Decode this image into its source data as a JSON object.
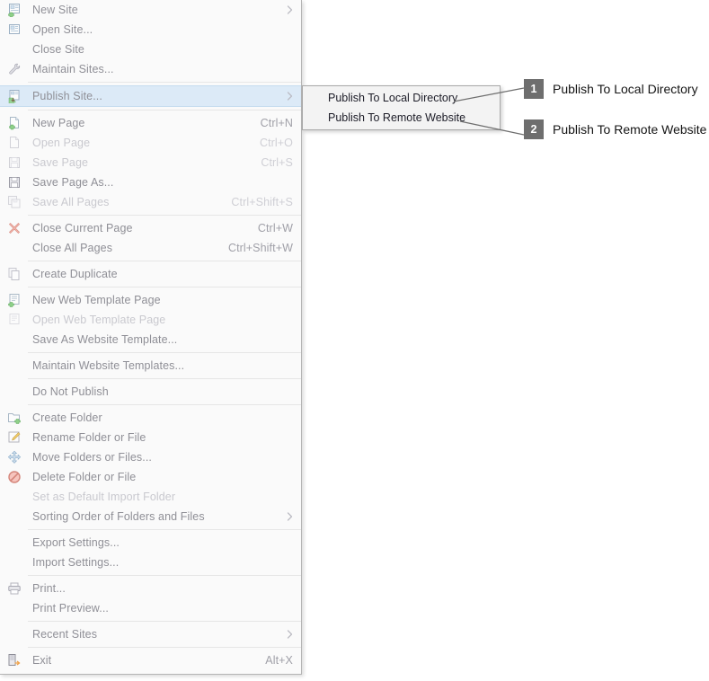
{
  "menu": {
    "title": "File Menu",
    "groups": [
      {
        "items": [
          {
            "label": "New Site",
            "shortcut": "",
            "icon": "new-site-icon",
            "submenu": true,
            "disabled": false
          },
          {
            "label": "Open Site...",
            "shortcut": "",
            "icon": "open-site-icon",
            "submenu": false,
            "disabled": false
          },
          {
            "label": "Close Site",
            "shortcut": "",
            "icon": "",
            "submenu": false,
            "disabled": false
          },
          {
            "label": "Maintain Sites...",
            "shortcut": "",
            "icon": "wrench-icon",
            "submenu": false,
            "disabled": false
          }
        ]
      },
      {
        "items": [
          {
            "label": "Publish Site...",
            "shortcut": "",
            "icon": "publish-site-icon",
            "submenu": true,
            "disabled": false,
            "selected": true
          }
        ]
      },
      {
        "items": [
          {
            "label": "New Page",
            "shortcut": "Ctrl+N",
            "icon": "new-page-icon",
            "submenu": false,
            "disabled": false
          },
          {
            "label": "Open Page",
            "shortcut": "Ctrl+O",
            "icon": "open-page-icon",
            "submenu": false,
            "disabled": true
          },
          {
            "label": "Save Page",
            "shortcut": "Ctrl+S",
            "icon": "save-page-icon",
            "submenu": false,
            "disabled": true
          },
          {
            "label": "Save Page As...",
            "shortcut": "",
            "icon": "save-page-as-icon",
            "submenu": false,
            "disabled": false
          },
          {
            "label": "Save All Pages",
            "shortcut": "Ctrl+Shift+S",
            "icon": "save-all-pages-icon",
            "submenu": false,
            "disabled": true
          }
        ]
      },
      {
        "items": [
          {
            "label": "Close Current Page",
            "shortcut": "Ctrl+W",
            "icon": "close-x-icon",
            "submenu": false,
            "disabled": false
          },
          {
            "label": "Close All Pages",
            "shortcut": "Ctrl+Shift+W",
            "icon": "",
            "submenu": false,
            "disabled": false
          }
        ]
      },
      {
        "items": [
          {
            "label": "Create Duplicate",
            "shortcut": "",
            "icon": "duplicate-icon",
            "submenu": false,
            "disabled": false
          }
        ]
      },
      {
        "items": [
          {
            "label": "New Web Template Page",
            "shortcut": "",
            "icon": "new-template-icon",
            "submenu": false,
            "disabled": false
          },
          {
            "label": "Open Web Template Page",
            "shortcut": "",
            "icon": "open-template-icon",
            "submenu": false,
            "disabled": true
          },
          {
            "label": "Save As Website Template...",
            "shortcut": "",
            "icon": "",
            "submenu": false,
            "disabled": false
          }
        ]
      },
      {
        "items": [
          {
            "label": "Maintain Website Templates...",
            "shortcut": "",
            "icon": "",
            "submenu": false,
            "disabled": false
          }
        ]
      },
      {
        "items": [
          {
            "label": "Do Not Publish",
            "shortcut": "",
            "icon": "",
            "submenu": false,
            "disabled": false
          }
        ]
      },
      {
        "items": [
          {
            "label": "Create Folder",
            "shortcut": "",
            "icon": "create-folder-icon",
            "submenu": false,
            "disabled": false
          },
          {
            "label": "Rename Folder or File",
            "shortcut": "",
            "icon": "rename-pencil-icon",
            "submenu": false,
            "disabled": false
          },
          {
            "label": "Move Folders or Files...",
            "shortcut": "",
            "icon": "move-arrows-icon",
            "submenu": false,
            "disabled": false
          },
          {
            "label": "Delete Folder or File",
            "shortcut": "",
            "icon": "delete-forbidden-icon",
            "submenu": false,
            "disabled": false
          },
          {
            "label": "Set as Default Import Folder",
            "shortcut": "",
            "icon": "",
            "submenu": false,
            "disabled": true
          },
          {
            "label": "Sorting Order of Folders and Files",
            "shortcut": "",
            "icon": "",
            "submenu": true,
            "disabled": false
          }
        ]
      },
      {
        "items": [
          {
            "label": "Export Settings...",
            "shortcut": "",
            "icon": "",
            "submenu": false,
            "disabled": false
          },
          {
            "label": "Import Settings...",
            "shortcut": "",
            "icon": "",
            "submenu": false,
            "disabled": false
          }
        ]
      },
      {
        "items": [
          {
            "label": "Print...",
            "shortcut": "",
            "icon": "printer-icon",
            "submenu": false,
            "disabled": false
          },
          {
            "label": "Print Preview...",
            "shortcut": "",
            "icon": "",
            "submenu": false,
            "disabled": false
          }
        ]
      },
      {
        "items": [
          {
            "label": "Recent Sites",
            "shortcut": "",
            "icon": "",
            "submenu": true,
            "disabled": false
          }
        ]
      },
      {
        "items": [
          {
            "label": "Exit",
            "shortcut": "Alt+X",
            "icon": "exit-door-icon",
            "submenu": false,
            "disabled": false
          }
        ]
      }
    ]
  },
  "submenu": {
    "items": [
      {
        "label": "Publish To Local Directory"
      },
      {
        "label": "Publish To Remote Website"
      }
    ]
  },
  "callouts": [
    {
      "number": "1",
      "label": "Publish To Local Directory"
    },
    {
      "number": "2",
      "label": "Publish To Remote Website"
    }
  ],
  "colors": {
    "menu_background": "#fafafa",
    "selected_row": "#dceaf7",
    "submenu_background": "#f3f3f3",
    "label_text": "#8f8f96",
    "disabled_text": "#c9c9cf",
    "badge_background": "#6e6e6e",
    "callout_text": "#141414",
    "leader_line": "#6e6e6e"
  }
}
